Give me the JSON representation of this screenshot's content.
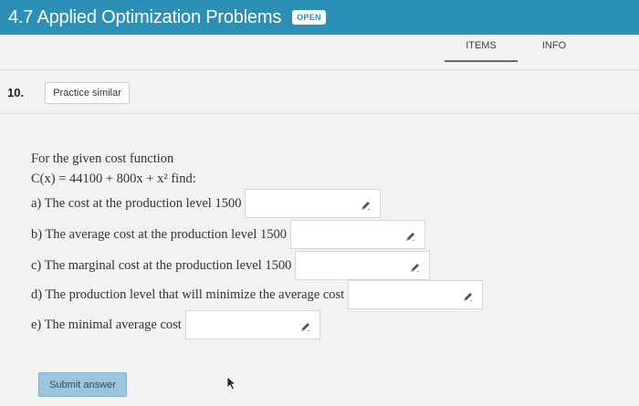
{
  "header": {
    "title": "4.7 Applied Optimization Problems",
    "badge": "OPEN",
    "bg_color": "#2c8fb5"
  },
  "tabs": [
    {
      "label": "ITEMS",
      "active": true
    },
    {
      "label": "INFO",
      "active": false
    }
  ],
  "question": {
    "number": "10.",
    "practice_label": "Practice similar",
    "intro": "For the given cost function",
    "function_text": "C(x) = 44100 + 800x + x² find:",
    "parts": [
      {
        "label": "a) The cost at the production level 1500",
        "value": ""
      },
      {
        "label": "b) The average cost at the production level 1500",
        "value": ""
      },
      {
        "label": "c) The marginal cost at the production level 1500",
        "value": ""
      },
      {
        "label": "d) The production level that will minimize the average cost",
        "value": ""
      },
      {
        "label": "e) The minimal average cost",
        "value": ""
      }
    ],
    "submit_label": "Submit answer",
    "input_icon": "pencil-icon"
  }
}
